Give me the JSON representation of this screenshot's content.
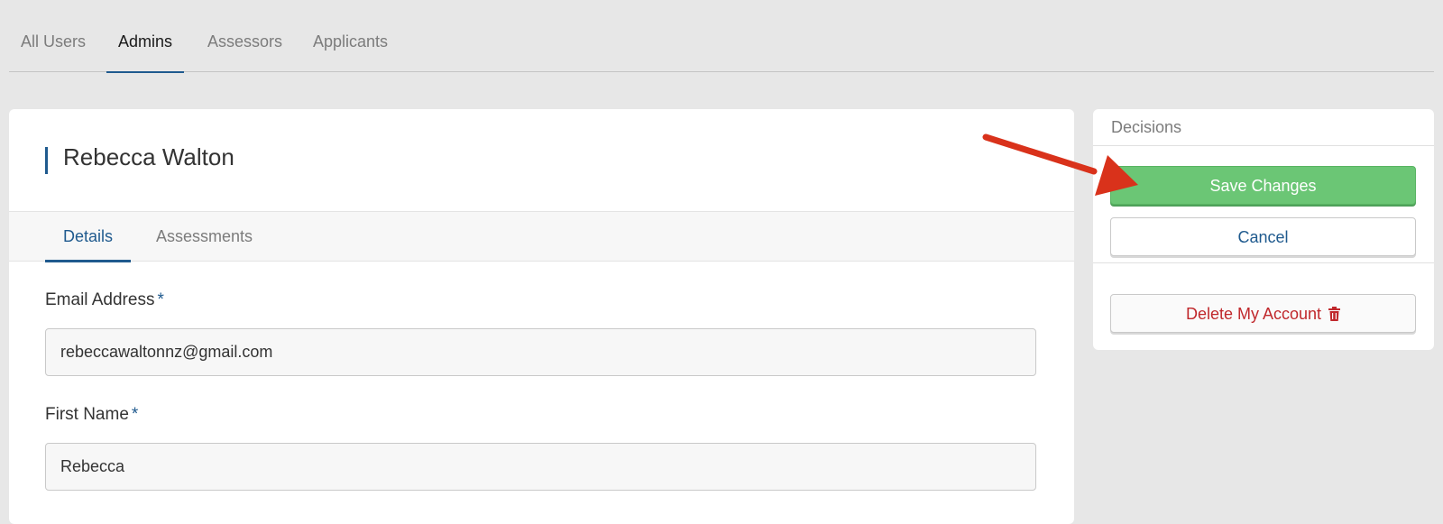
{
  "top_tabs": [
    {
      "label": "All Users"
    },
    {
      "label": "Admins"
    },
    {
      "label": "Assessors"
    },
    {
      "label": "Applicants"
    }
  ],
  "active_top_tab": "Admins",
  "user": {
    "name": "Rebecca Walton"
  },
  "sub_tabs": [
    {
      "label": "Details"
    },
    {
      "label": "Assessments"
    }
  ],
  "active_sub_tab": "Details",
  "form": {
    "email": {
      "label": "Email Address",
      "required_mark": "*",
      "value": "rebeccawaltonnz@gmail.com"
    },
    "first_name": {
      "label": "First Name",
      "required_mark": "*",
      "value": "Rebecca"
    }
  },
  "decisions": {
    "title": "Decisions",
    "save_label": "Save Changes",
    "cancel_label": "Cancel",
    "delete_label": "Delete My Account",
    "delete_icon": "trash-icon"
  },
  "annotation": {
    "arrow_color": "#d9321b",
    "arrow_target": "Save Changes"
  },
  "colors": {
    "accent": "#1f5a8e",
    "save_green": "#6bc675",
    "danger_red": "#c0282c",
    "background": "#e7e7e7"
  }
}
